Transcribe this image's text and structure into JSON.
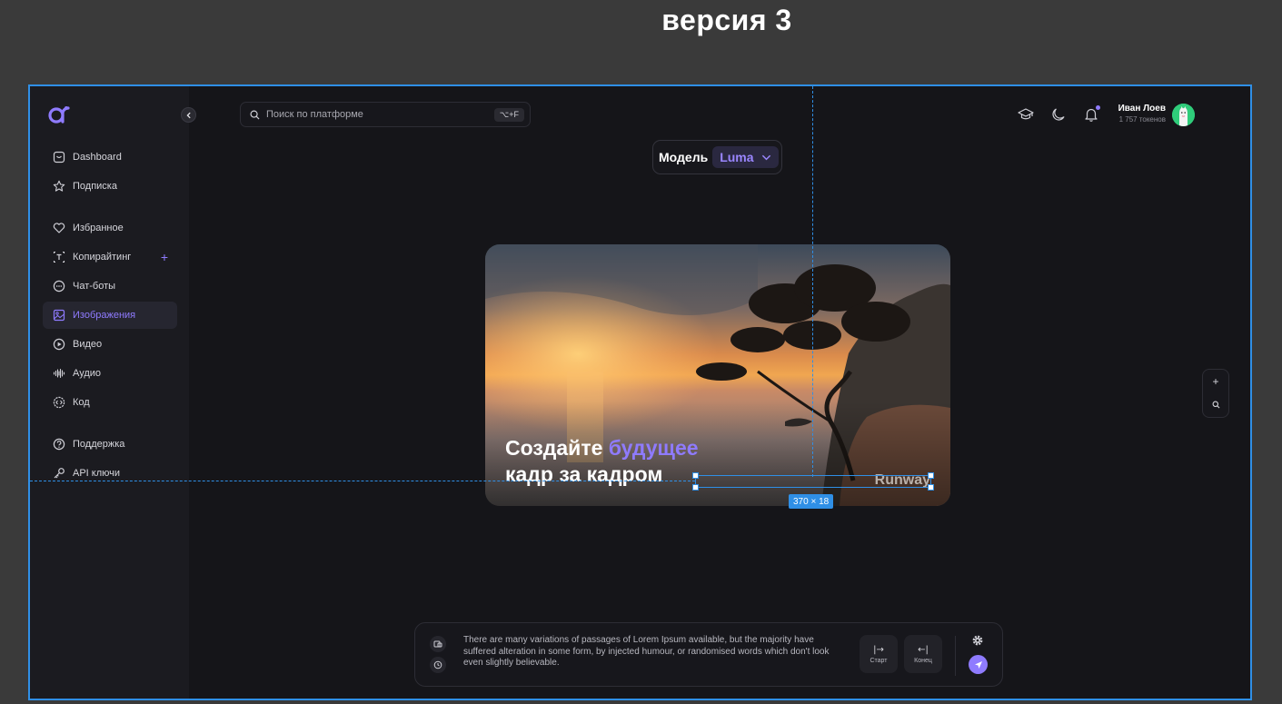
{
  "version_title": "версия 3",
  "sidebar": {
    "items": [
      {
        "label": "Dashboard",
        "icon": "dashboard-icon"
      },
      {
        "label": "Подписка",
        "icon": "star-icon"
      },
      {
        "label": "Избранное",
        "icon": "heart-icon"
      },
      {
        "label": "Копирайтинг",
        "icon": "text-icon",
        "action": "+"
      },
      {
        "label": "Чат-боты",
        "icon": "chat-icon"
      },
      {
        "label": "Изображения",
        "icon": "image-icon",
        "active": true
      },
      {
        "label": "Видео",
        "icon": "play-icon"
      },
      {
        "label": "Аудио",
        "icon": "waveform-icon"
      },
      {
        "label": "Код",
        "icon": "code-icon"
      },
      {
        "label": "Поддержка",
        "icon": "help-icon"
      },
      {
        "label": "API ключи",
        "icon": "key-icon"
      }
    ]
  },
  "header": {
    "search_placeholder": "Поиск по платформе",
    "search_shortcut": "⌥+F",
    "user_name": "Иван Лоев",
    "user_tokens": "1 757 токенов"
  },
  "model": {
    "label": "Модель",
    "selected": "Luma"
  },
  "hero": {
    "title_plain": "Создайте ",
    "title_accent": "будущее",
    "title_line2": "кадр за кадром",
    "brand": "Runway"
  },
  "selection": {
    "dimensions": "370 × 18"
  },
  "zoom": {
    "plus": "+"
  },
  "composer": {
    "text": "There are many variations of passages of Lorem Ipsum available, but the majority have suffered alteration in some form, by injected humour, or randomised words which don't look even slightly believable.",
    "start_label": "Старт",
    "end_label": "Конец",
    "start_glyph": "|→",
    "end_glyph": "←|"
  },
  "colors": {
    "accent": "#8f7bff",
    "selection": "#2f8fe6",
    "background": "#151519",
    "sidebar": "#1b1b20"
  }
}
